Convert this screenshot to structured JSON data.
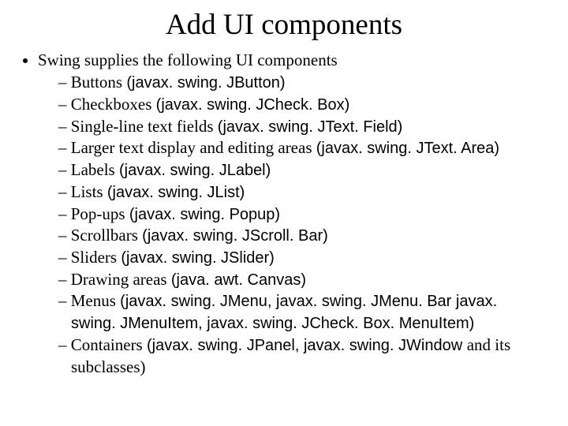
{
  "title": "Add UI components",
  "bullet": "Swing supplies the following UI components",
  "items": [
    {
      "label": "Buttons ",
      "api": "(javax. swing. JButton)"
    },
    {
      "label": "Checkboxes ",
      "api": "(javax. swing. JCheck. Box)"
    },
    {
      "label": "Single-line text fields ",
      "api": "(javax. swing. JText. Field)"
    },
    {
      "label": "Larger text display and editing areas ",
      "api": "(javax. swing. JText. Area)"
    },
    {
      "label": "Labels ",
      "api": "(javax. swing. JLabel)"
    },
    {
      "label": "Lists ",
      "api": "(javax. swing. JList)"
    },
    {
      "label": "Pop-ups ",
      "api": "(javax. swing. Popup)"
    },
    {
      "label": "Scrollbars ",
      "api": "(javax. swing. JScroll. Bar)"
    },
    {
      "label": "Sliders ",
      "api": "(javax. swing. JSlider)"
    },
    {
      "label": "Drawing areas ",
      "api": "(java. awt. Canvas)"
    },
    {
      "label": "Menus ",
      "api": "(javax. swing. JMenu, javax. swing. JMenu. Bar javax. swing. JMenuItem, javax. swing. JCheck. Box. MenuItem)"
    },
    {
      "label": "Containers ",
      "api": "(javax. swing. JPanel, javax. swing. JWindow ",
      "trail": "and its subclasses)"
    }
  ]
}
